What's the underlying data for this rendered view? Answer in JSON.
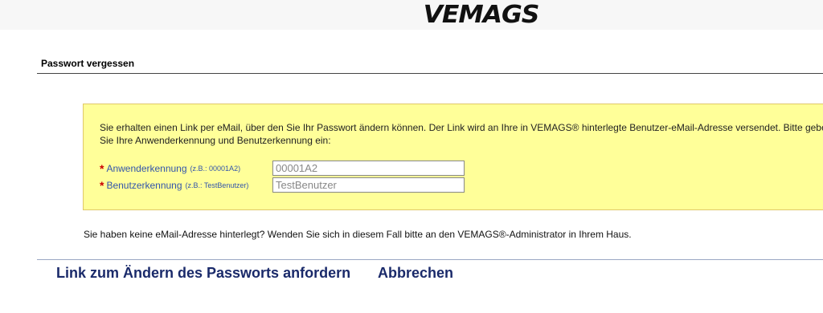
{
  "header": {
    "logo_text": "VEMAGS",
    "logo_icon": "vemags-swoosh-logo"
  },
  "page": {
    "title": "Passwort vergessen"
  },
  "info": {
    "text": "Sie erhalten einen Link per eMail, über den Sie Ihr Passwort ändern können. Der Link wird an Ihre in VEMAGS® hinterlegte Benutzer-eMail-Adresse versendet. Bitte geben Sie Ihre Anwenderkennung und Benutzerkennung ein:"
  },
  "form": {
    "required_marker": "*",
    "anwender": {
      "label": "Anwenderkennung",
      "hint": "(z.B.: 00001A2)",
      "placeholder": "00001A2",
      "value": ""
    },
    "benutzer": {
      "label": "Benutzerkennung",
      "hint": "(z.B.: TestBenutzer)",
      "placeholder": "TestBenutzer",
      "value": ""
    }
  },
  "note": {
    "text": "Sie haben keine eMail-Adresse hinterlegt? Wenden Sie sich in diesem Fall bitte an den VEMAGS®-Administrator in Ihrem Haus."
  },
  "actions": {
    "request_label": "Link zum Ändern des Passworts anfordern",
    "cancel_label": "Abbrechen"
  },
  "colors": {
    "info_background": "#ffff99",
    "label_blue": "#3355aa",
    "required_red": "#cc0000",
    "link_navy": "#1a2a6a"
  }
}
